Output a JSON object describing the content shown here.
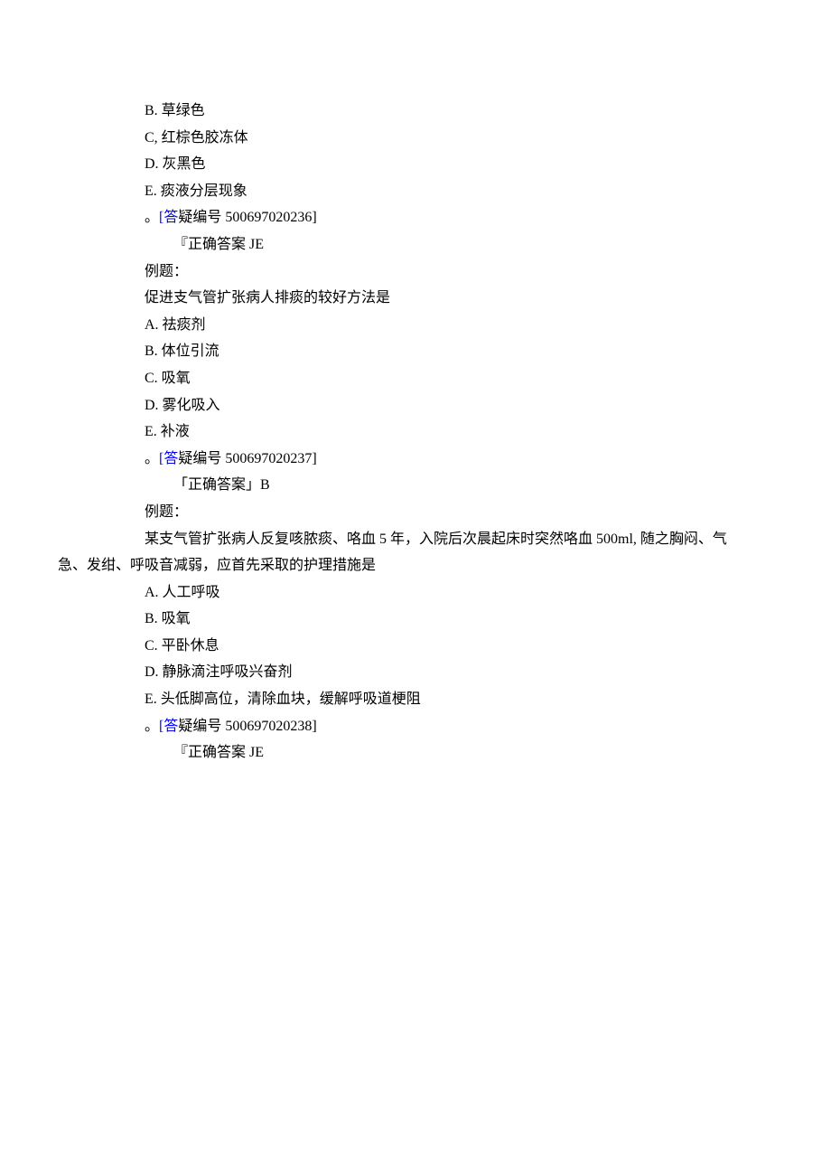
{
  "q1": {
    "options": {
      "b": "B. 草绿色",
      "c": "C, 红棕色胶冻体",
      "d": "D. 灰黑色",
      "e": "E. 痰液分层现象"
    },
    "answer_prefix": "。",
    "answer_link": "[答",
    "answer_code": "疑编号 500697020236]",
    "answer_correct": "『正确答案 JE"
  },
  "q2": {
    "header": "例题：",
    "stem": "促进支气管扩张病人排痰的较好方法是",
    "options": {
      "a": "A. 祛痰剂",
      "b": "B. 体位引流",
      "c": "C. 吸氧",
      "d": "D. 雾化吸入",
      "e": "E. 补液"
    },
    "answer_prefix": "。",
    "answer_link": "[答",
    "answer_code": "疑编号 500697020237]",
    "answer_correct": "「正确答案」B"
  },
  "q3": {
    "header": "例题：",
    "stem_line1": "某支气管扩张病人反复咳脓痰、咯血 5 年，入院后次晨起床时突然咯血 500ml, 随之胸闷、气",
    "stem_line2": "急、发绀、呼吸音减弱，应首先采取的护理措施是",
    "options": {
      "a": "A. 人工呼吸",
      "b": "B. 吸氧",
      "c": "C. 平卧休息",
      "d": "D. 静脉滴注呼吸兴奋剂",
      "e": "E. 头低脚高位，清除血块，缓解呼吸道梗阻"
    },
    "answer_prefix": "。",
    "answer_link": "[答",
    "answer_code": "疑编号 500697020238]",
    "answer_correct": "『正确答案 JE"
  }
}
